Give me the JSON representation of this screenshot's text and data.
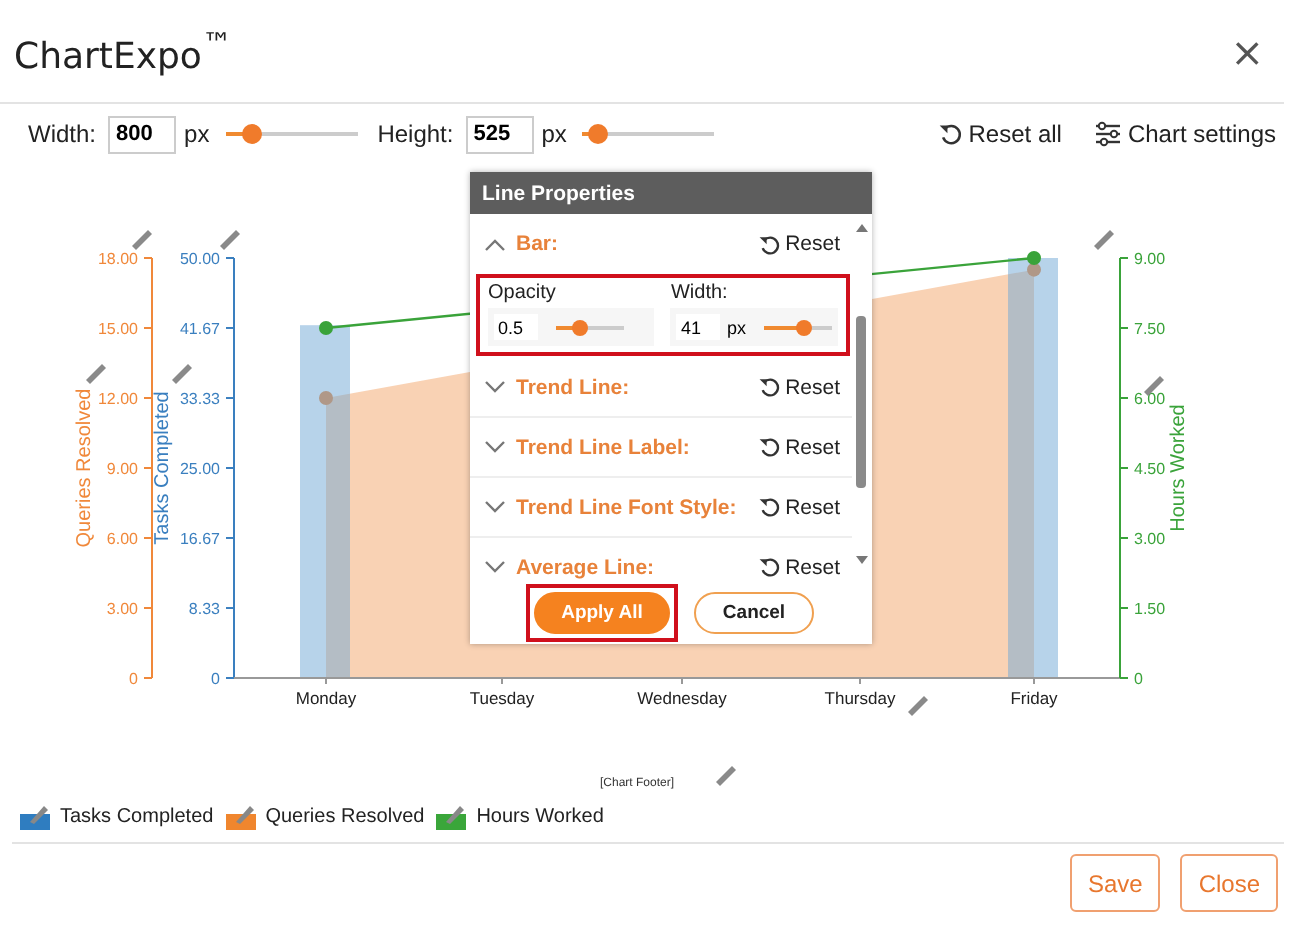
{
  "window": {
    "title": "ChartExpo$^{™}$",
    "close": "×"
  },
  "toolbar": {
    "fields": [
      {
        "label": "Width:",
        "value": "800",
        "unit": "px",
        "level": 0.2
      },
      {
        "label": "Height:",
        "value": "525",
        "unit": "px",
        "level": 0.12
      }
    ],
    "actions": [
      {
        "label": "Reset all",
        "kind": "reset"
      },
      {
        "label": "Chart settings",
        "kind": "settings"
      }
    ]
  },
  "chart": {
    "tasks": {
      "chart_data": {
        "type": "bar",
        "ylabel": "Tasks Completed",
        "categories": [
          "Monday",
          "Tuesday",
          "Wednesday",
          "Thursday",
          "Friday"
        ],
        "ylim": [
          0,
          50
        ],
        "yticks": [
          0,
          {
            "value": 8.33,
            "label": "8.33"
          },
          {
            "value": 16.67,
            "label": "16.67"
          },
          {
            "value": 25,
            "label": "25.00"
          },
          {
            "value": 33.33,
            "label": "33.33"
          },
          {
            "value": 41.67,
            "label": "41.67"
          },
          {
            "value": 50,
            "label": "50.00"
          }
        ],
        "series": [
          {
            "color": "#6fa8d6",
            "values": [
              42,
              null,
              null,
              null,
              50
            ]
          }
        ]
      }
    },
    "queries": {
      "chart_data": {
        "type": "area",
        "ylabel": "Queries Resolved",
        "ylim": [
          0,
          18
        ],
        "yticks": [
          0,
          {
            "value": 3,
            "label": "3.00"
          },
          {
            "value": 6,
            "label": "6.00"
          },
          {
            "value": 9,
            "label": "9.00"
          },
          {
            "value": 12,
            "label": "12.00"
          },
          {
            "value": 15,
            "label": "15.00"
          },
          {
            "value": 18,
            "label": "18.00"
          }
        ],
        "series": [
          {
            "color": "#f0883a",
            "marker": true,
            "values": [
              12,
              null,
              null,
              null,
              17.5
            ]
          }
        ]
      }
    },
    "hours": {
      "chart_data": {
        "type": "line",
        "ylabel": "Hours Worked",
        "ylim": [
          0,
          9
        ],
        "yticks": [
          0,
          {
            "value": 1.5,
            "label": "1.50"
          },
          {
            "value": 3,
            "label": "3.00"
          },
          {
            "value": 4.5,
            "label": "4.50"
          },
          {
            "value": 6,
            "label": "6.00"
          },
          {
            "value": 7.5,
            "label": "7.50"
          },
          {
            "value": 9,
            "label": "9.00"
          }
        ],
        "series": [
          {
            "color": "#3aa33a",
            "marker": true,
            "values": [
              7.5,
              null,
              null,
              null,
              9
            ]
          }
        ]
      }
    },
    "footer": "[Chart Footer]",
    "legend": [
      {
        "label": "Tasks Completed",
        "color": "#2f7dc0"
      },
      {
        "label": "Queries Resolved",
        "color": "#f0862e"
      },
      {
        "label": "Hours Worked",
        "color": "#3aa63a"
      }
    ]
  },
  "line_properties": {
    "title": "Line Properties",
    "sections": [
      {
        "label": "Bar:",
        "expanded": true,
        "reset": "Reset",
        "highlighted": true,
        "fields": [
          {
            "label": "Opacity",
            "value": "0.5",
            "level": 0.35
          },
          {
            "label": "Width:",
            "value": "41",
            "unit": "px",
            "level": 0.6
          }
        ]
      },
      {
        "label": "Trend Line:",
        "expanded": false,
        "reset": "Reset"
      },
      {
        "label": "Trend Line Label:",
        "expanded": false,
        "reset": "Reset"
      },
      {
        "label": "Trend Line Font Style:",
        "expanded": false,
        "reset": "Reset"
      },
      {
        "label": "Average Line:",
        "expanded": false,
        "reset": "Reset"
      }
    ],
    "buttons": [
      {
        "label": "Apply All",
        "kind": "primary",
        "highlighted": true
      },
      {
        "label": "Cancel",
        "kind": "secondary",
        "highlighted": false
      }
    ]
  },
  "footer_buttons": [
    {
      "label": "Save"
    },
    {
      "label": "Close"
    }
  ]
}
